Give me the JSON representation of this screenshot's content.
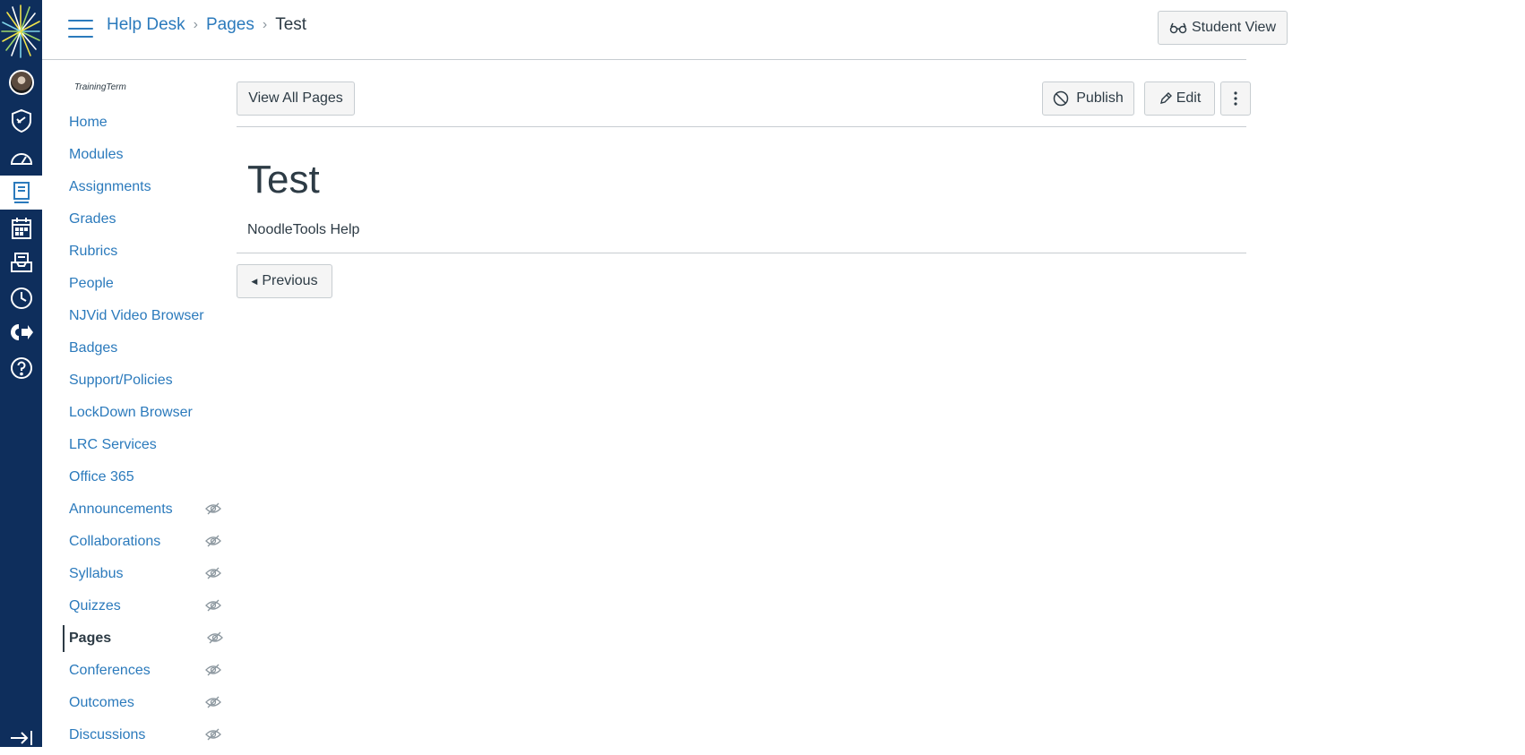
{
  "header": {
    "breadcrumbs": [
      "Help Desk",
      "Pages",
      "Test"
    ],
    "student_view_label": "Student View"
  },
  "course_nav": {
    "term": "TrainingTerm",
    "items": [
      {
        "label": "Home"
      },
      {
        "label": "Modules"
      },
      {
        "label": "Assignments"
      },
      {
        "label": "Grades"
      },
      {
        "label": "Rubrics"
      },
      {
        "label": "People"
      },
      {
        "label": "NJVid Video Browser"
      },
      {
        "label": "Badges"
      },
      {
        "label": "Support/Policies"
      },
      {
        "label": "LockDown Browser"
      },
      {
        "label": "LRC Services"
      },
      {
        "label": "Office 365"
      },
      {
        "label": "Announcements",
        "hidden": true
      },
      {
        "label": "Collaborations",
        "hidden": true
      },
      {
        "label": "Syllabus",
        "hidden": true
      },
      {
        "label": "Quizzes",
        "hidden": true
      },
      {
        "label": "Pages",
        "hidden": true,
        "active": true
      },
      {
        "label": "Conferences",
        "hidden": true
      },
      {
        "label": "Outcomes",
        "hidden": true
      },
      {
        "label": "Discussions",
        "hidden": true
      }
    ]
  },
  "toolbar": {
    "view_all_label": "View All Pages",
    "publish_label": "Publish",
    "edit_label": "Edit"
  },
  "page": {
    "title": "Test",
    "body": "NoodleTools Help",
    "previous_label": "Previous"
  },
  "colors": {
    "nav_bg": "#0e2e5c",
    "link": "#2b7abc",
    "text": "#2d3b45"
  }
}
